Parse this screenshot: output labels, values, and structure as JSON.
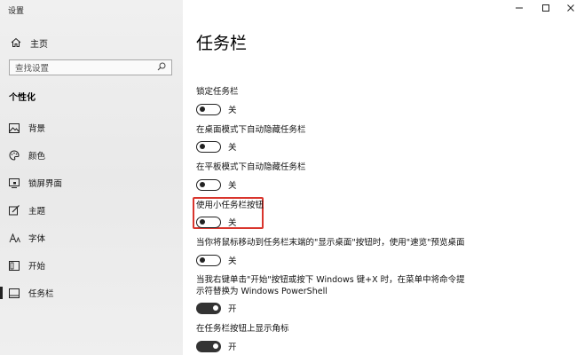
{
  "window": {
    "title": "设置"
  },
  "sidebar": {
    "home_label": "主页",
    "search_placeholder": "查找设置",
    "section_title": "个性化",
    "items": [
      {
        "label": "背景",
        "icon": "picture-icon",
        "selected": false
      },
      {
        "label": "颜色",
        "icon": "palette-icon",
        "selected": false
      },
      {
        "label": "锁屏界面",
        "icon": "lock-screen-icon",
        "selected": false
      },
      {
        "label": "主题",
        "icon": "theme-brush-icon",
        "selected": false
      },
      {
        "label": "字体",
        "icon": "font-icon",
        "selected": false
      },
      {
        "label": "开始",
        "icon": "start-icon",
        "selected": false
      },
      {
        "label": "任务栏",
        "icon": "taskbar-icon",
        "selected": true
      }
    ]
  },
  "main": {
    "title": "任务栏",
    "settings": [
      {
        "label": "锁定任务栏",
        "state": "关",
        "on": false
      },
      {
        "label": "在桌面模式下自动隐藏任务栏",
        "state": "关",
        "on": false
      },
      {
        "label": "在平板模式下自动隐藏任务栏",
        "state": "关",
        "on": false
      },
      {
        "label": "使用小任务栏按钮",
        "state": "关",
        "on": false,
        "highlighted": true
      },
      {
        "label": "当你将鼠标移动到任务栏末端的\"显示桌面\"按钮时，使用\"速览\"预览桌面",
        "state": "关",
        "on": false
      },
      {
        "label_line1": "当我右键单击\"开始\"按钮或按下 Windows 键+X 时，在菜单中将命令提",
        "label_line2": "示符替换为 Windows PowerShell",
        "state": "开",
        "on": true
      },
      {
        "label": "在任务栏按钮上显示角标",
        "state": "开",
        "on": true
      }
    ]
  },
  "colors": {
    "highlight": "#d9352d",
    "toggle_on": "#333333"
  }
}
